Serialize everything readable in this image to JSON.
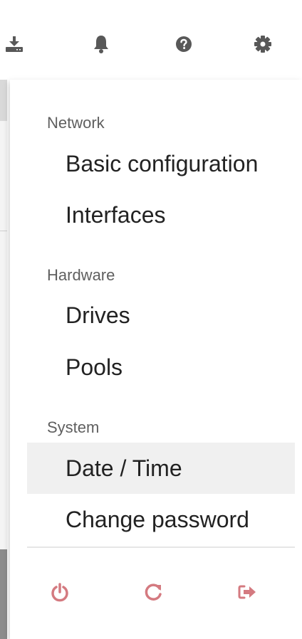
{
  "header": {
    "icons": [
      {
        "name": "download-icon",
        "color": "#585858"
      },
      {
        "name": "bell-icon",
        "color": "#585858"
      },
      {
        "name": "help-icon",
        "color": "#585858"
      },
      {
        "name": "gear-icon",
        "color": "#585858"
      }
    ]
  },
  "menu": {
    "sections": [
      {
        "label": "Network",
        "items": [
          "Basic configuration",
          "Interfaces"
        ]
      },
      {
        "label": "Hardware",
        "items": [
          "Drives",
          "Pools"
        ]
      },
      {
        "label": "System",
        "items": [
          "Date / Time",
          "Change password"
        ]
      }
    ],
    "active_item": "Date / Time",
    "footer_icons": [
      {
        "name": "power-icon",
        "color": "#d47a80"
      },
      {
        "name": "refresh-icon",
        "color": "#d47a80"
      },
      {
        "name": "logout-icon",
        "color": "#d47a80"
      }
    ]
  }
}
